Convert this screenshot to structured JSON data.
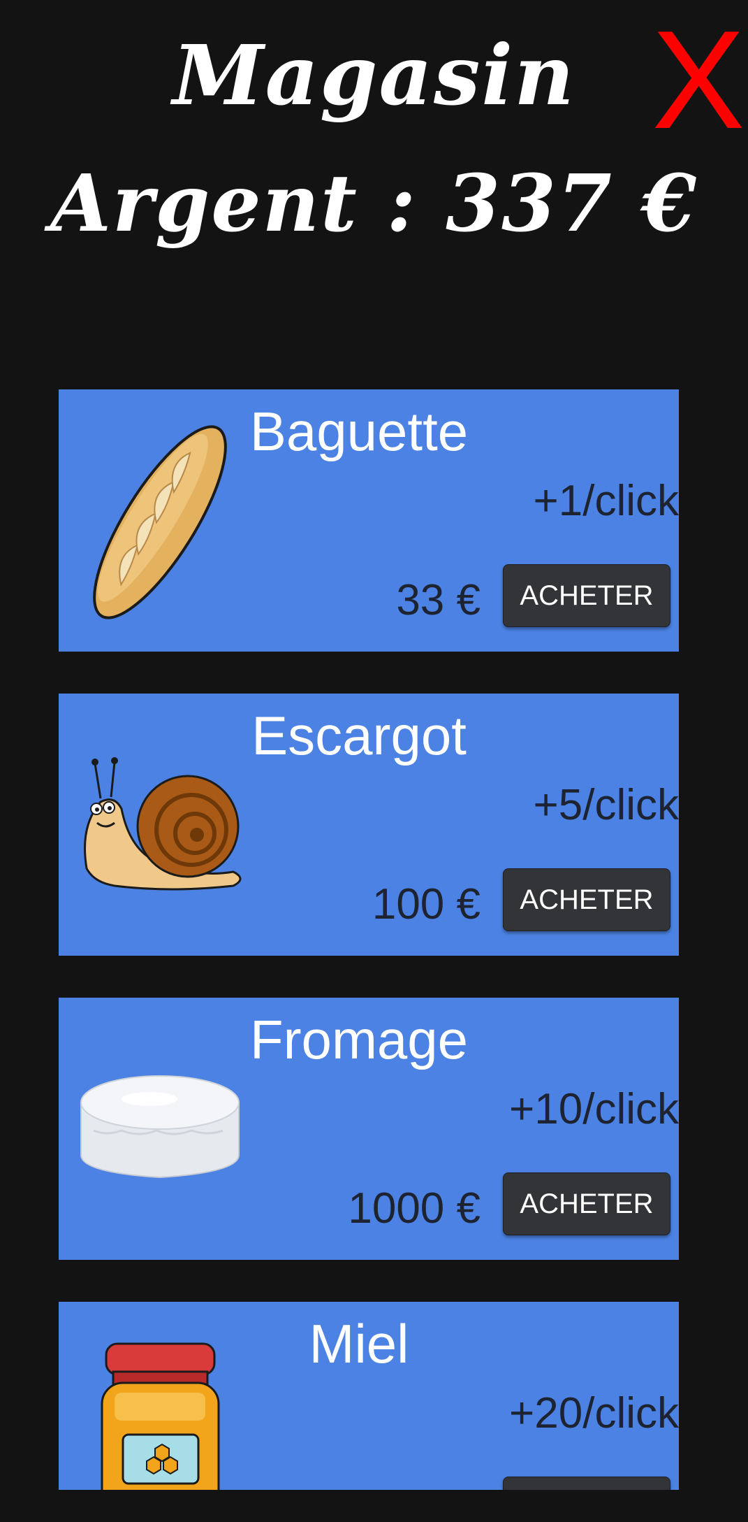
{
  "header": {
    "title": "Magasin",
    "money_line": "Argent : 337 €",
    "close_label": "X"
  },
  "items": [
    {
      "name": "Baguette",
      "rate": "+1/click",
      "price": "33 €",
      "button": "ACHETER",
      "icon": "baguette-icon"
    },
    {
      "name": "Escargot",
      "rate": "+5/click",
      "price": "100 €",
      "button": "ACHETER",
      "icon": "snail-icon"
    },
    {
      "name": "Fromage",
      "rate": "+10/click",
      "price": "1000 €",
      "button": "ACHETER",
      "icon": "cheese-icon"
    },
    {
      "name": "Miel",
      "rate": "+20/click",
      "price": "",
      "button": "",
      "icon": "honey-jar-icon"
    }
  ],
  "colors": {
    "background": "#131313",
    "card": "#4b82e3",
    "button": "#333437",
    "close": "#ff0000"
  }
}
